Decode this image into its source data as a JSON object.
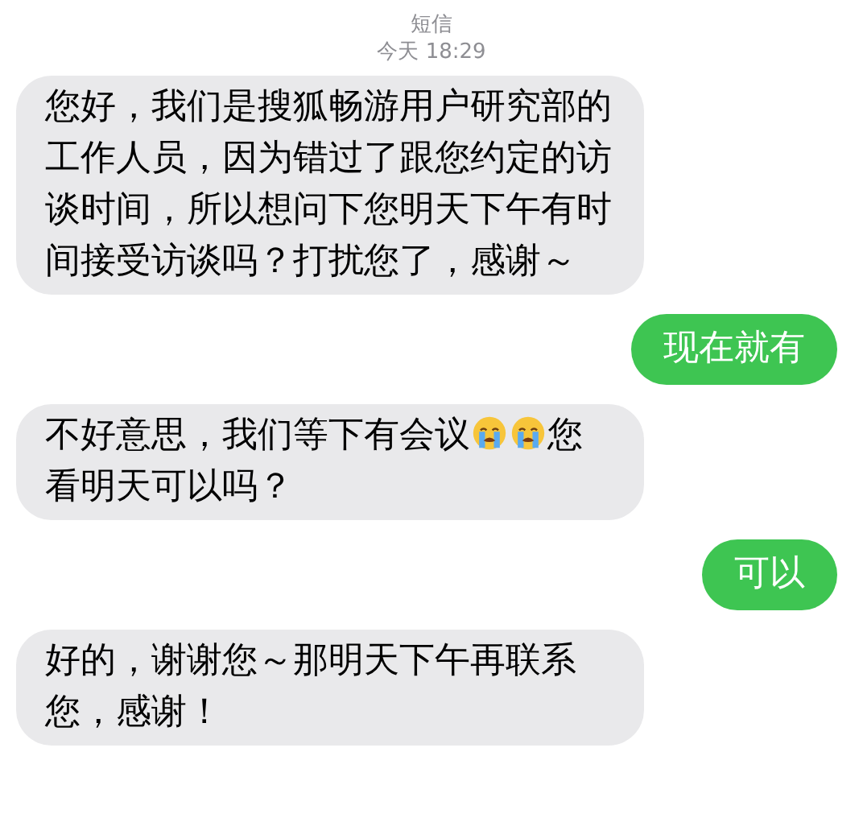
{
  "header": {
    "title": "短信",
    "timestamp": "今天 18:29"
  },
  "messages": [
    {
      "kind": "received",
      "segments": [
        {
          "kind": "text",
          "text": "您好，我们是搜狐畅游用户研究部的工作人员，因为错过了跟您约定的访谈时间，所以想问下您明天下午有时间接受访谈吗？打扰您了，感谢～"
        }
      ]
    },
    {
      "kind": "sent",
      "segments": [
        {
          "kind": "text",
          "text": "现在就有"
        }
      ]
    },
    {
      "kind": "received",
      "segments": [
        {
          "kind": "text",
          "text": "不好意思，我们等下有会议"
        },
        {
          "kind": "emoji"
        },
        {
          "kind": "emoji"
        },
        {
          "kind": "text",
          "text": "您"
        },
        {
          "kind": "text",
          "text": "看明天可以吗？"
        }
      ]
    },
    {
      "kind": "sent",
      "segments": [
        {
          "kind": "text",
          "text": "可以"
        }
      ]
    },
    {
      "kind": "received",
      "segments": [
        {
          "kind": "text",
          "text": "好的，谢谢您～那明天下午再联系您，感谢！"
        }
      ]
    }
  ]
}
